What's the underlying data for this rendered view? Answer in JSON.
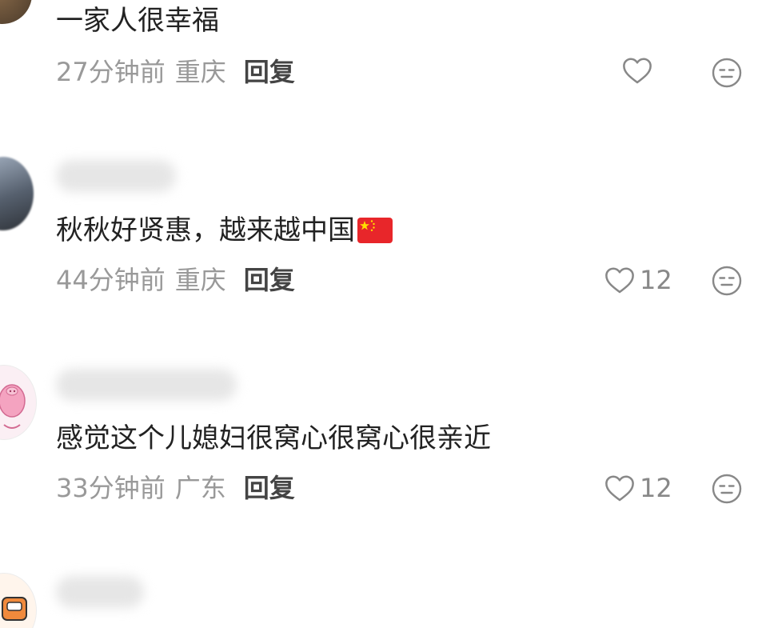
{
  "comments": [
    {
      "text": "一家人很幸福",
      "time": "27分钟前",
      "location": "重庆",
      "reply_label": "回复",
      "likes": ""
    },
    {
      "text": "秋秋好贤惠，越来越中国",
      "flag_icon": "china-flag-emoji",
      "time": "44分钟前",
      "location": "重庆",
      "reply_label": "回复",
      "likes": "12"
    },
    {
      "text": "感觉这个儿媳妇很窝心很窝心很亲近",
      "time": "33分钟前",
      "location": "广东",
      "reply_label": "回复",
      "likes": "12"
    }
  ],
  "icons": {
    "like": "heart-outline-icon",
    "react": "neutral-face-icon"
  },
  "colors": {
    "text": "#222222",
    "meta": "#999999",
    "reply": "#444444",
    "icon": "#888888"
  }
}
